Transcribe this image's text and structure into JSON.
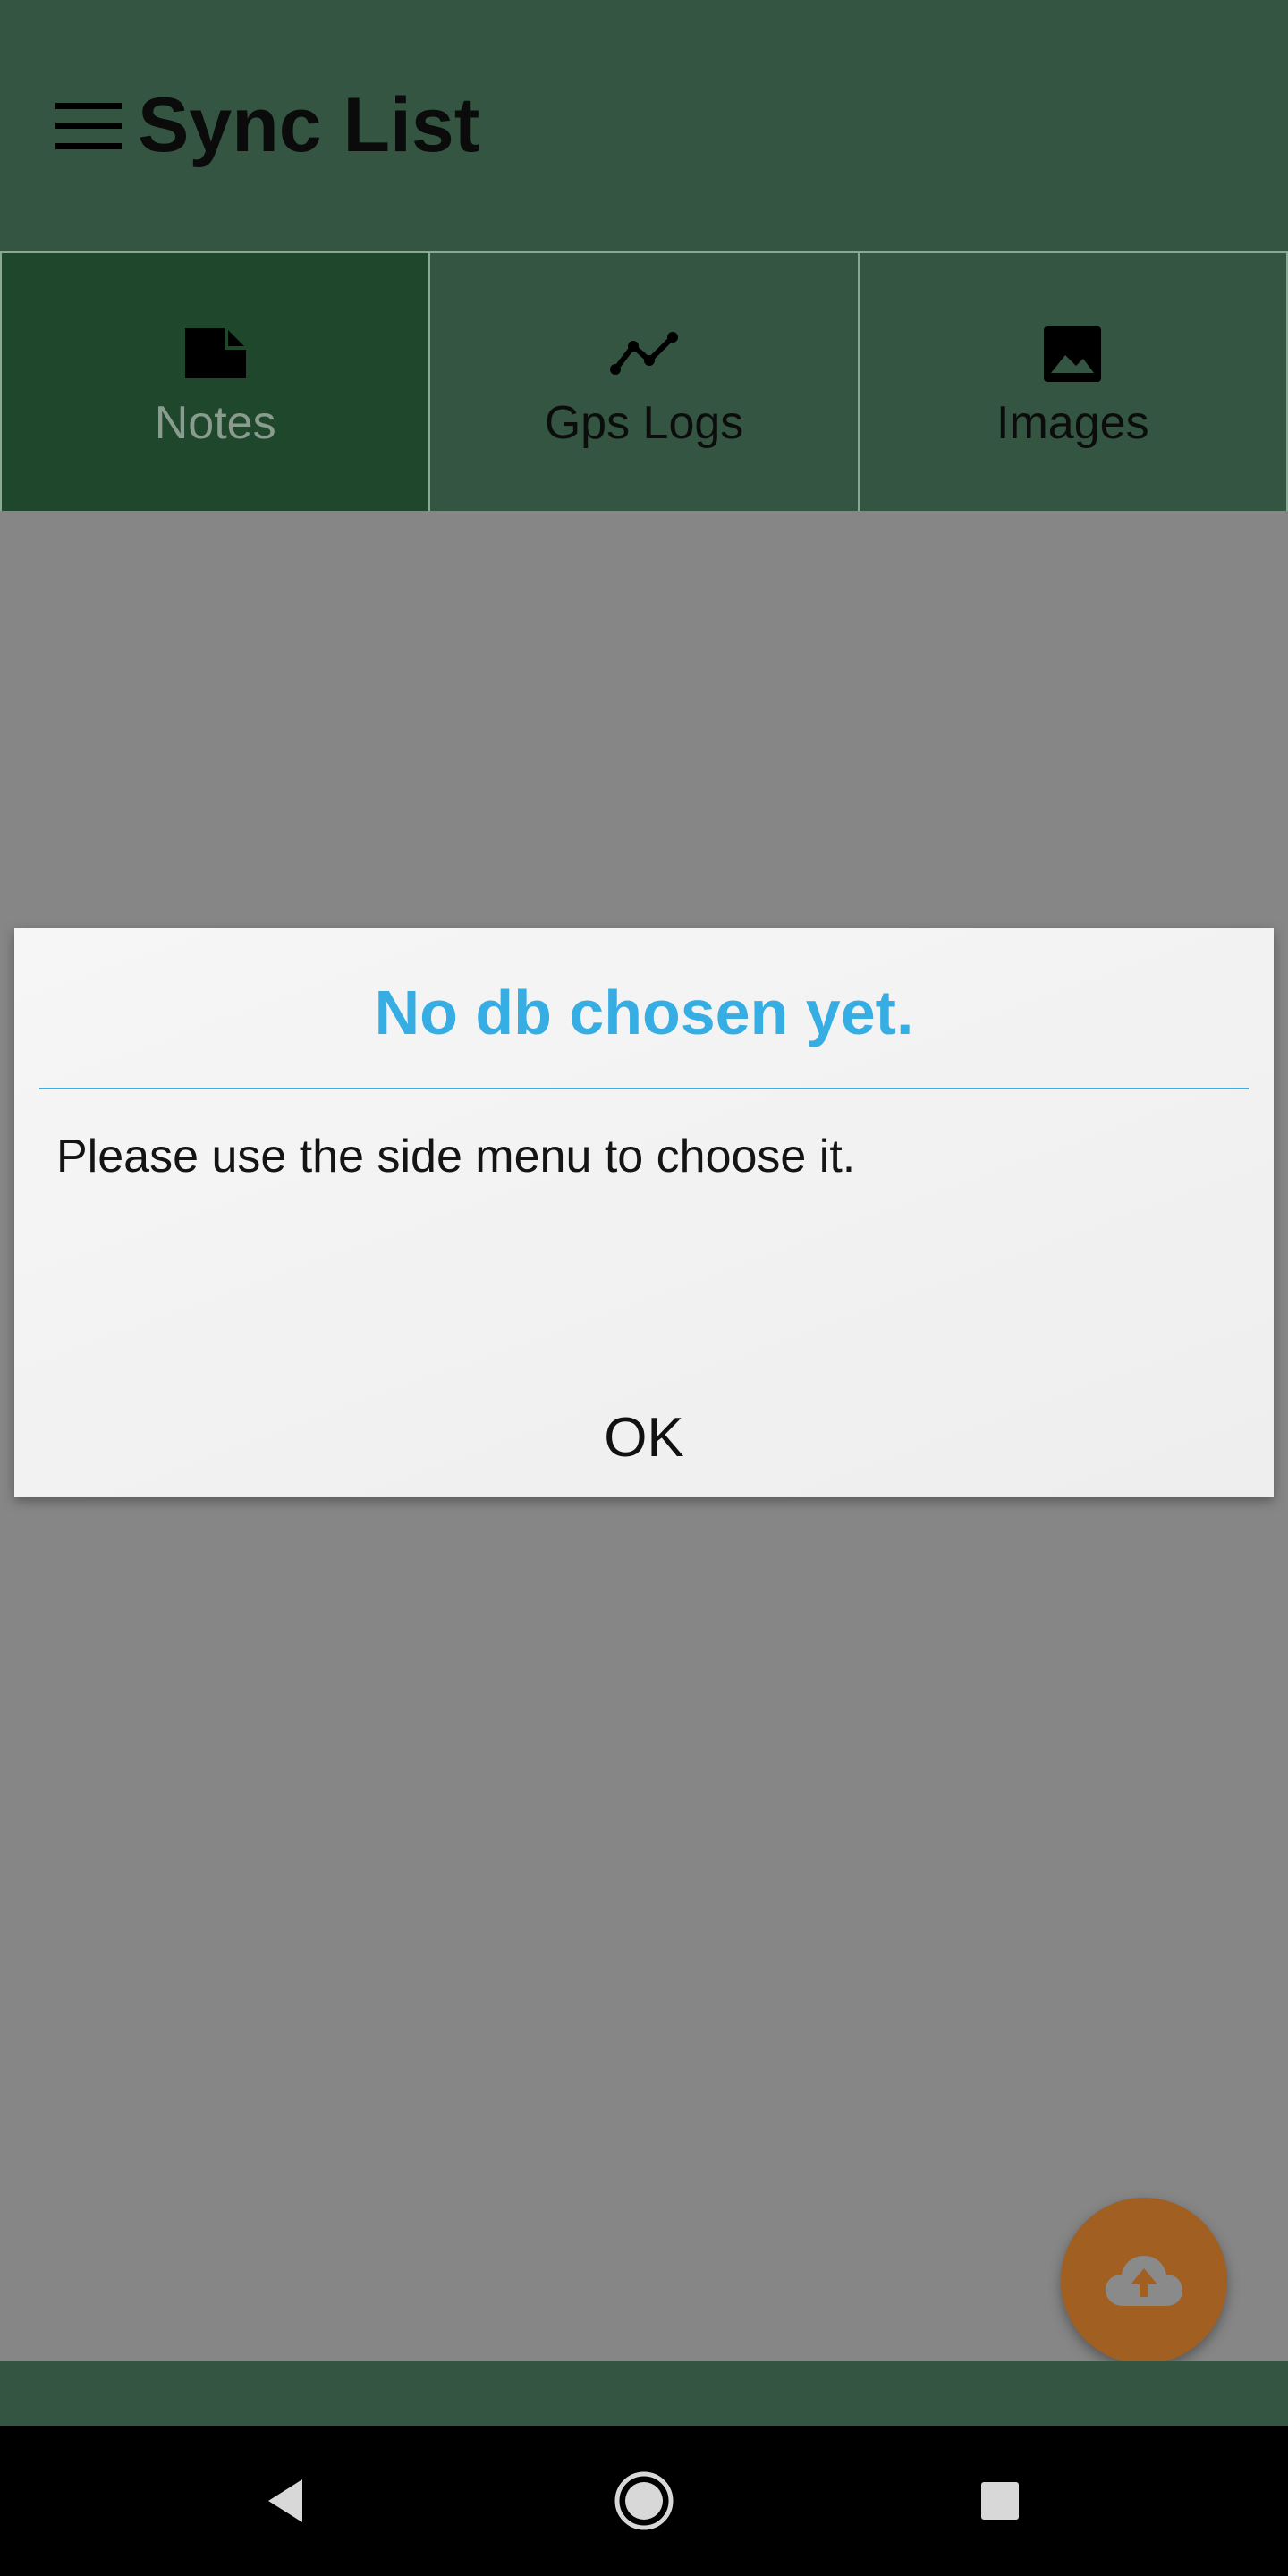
{
  "app_bar": {
    "title": "Sync List",
    "menu_icon": "hamburger-menu-icon",
    "background": "#335541"
  },
  "tabs": [
    {
      "label": "Notes",
      "icon": "note-icon",
      "active": true
    },
    {
      "label": "Gps Logs",
      "icon": "line-chart-icon",
      "active": false
    },
    {
      "label": "Images",
      "icon": "image-icon",
      "active": false
    }
  ],
  "dialog": {
    "title": "No db chosen yet.",
    "message": "Please use the side menu to choose it.",
    "ok_label": "OK",
    "accent": "#36aee3"
  },
  "fab": {
    "icon": "cloud-upload-icon",
    "color": "#a15f22"
  },
  "system_nav": {
    "back_icon": "back-triangle-icon",
    "home_icon": "home-circle-icon",
    "recents_icon": "recents-square-icon"
  }
}
